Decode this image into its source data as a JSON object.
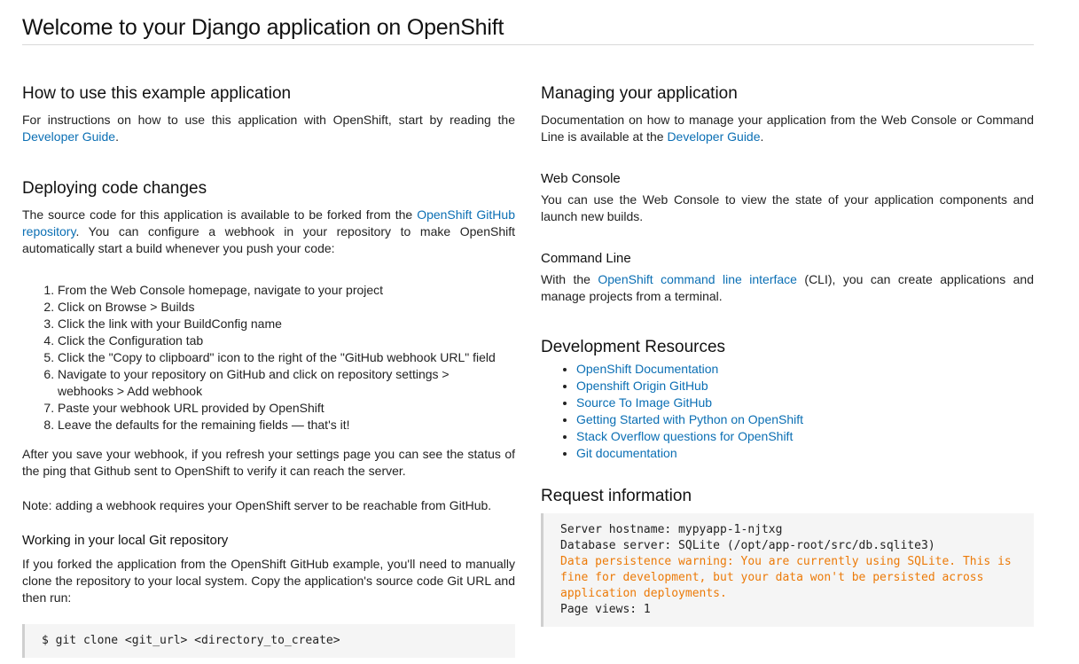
{
  "header": {
    "title": "Welcome to your Django application on OpenShift"
  },
  "left": {
    "how_to": {
      "heading": "How to use this example application",
      "text_before": "For instructions on how to use this application with OpenShift, start by reading the ",
      "link": "Developer Guide",
      "text_after": "."
    },
    "deploying": {
      "heading": "Deploying code changes",
      "text_before": "The source code for this application is available to be forked from the ",
      "link": "OpenShift GitHub repository",
      "text_after": ". You can configure a webhook in your repository to make OpenShift automatically start a build whenever you push your code:",
      "steps": [
        "From the Web Console homepage, navigate to your project",
        "Click on Browse > Builds",
        "Click the link with your BuildConfig name",
        "Click the Configuration tab",
        "Click the \"Copy to clipboard\" icon to the right of the \"GitHub webhook URL\" field",
        "Navigate to your repository on GitHub and click on repository settings > webhooks > Add webhook",
        "Paste your webhook URL provided by OpenShift",
        "Leave the defaults for the remaining fields — that's it!"
      ],
      "after_text": "After you save your webhook, if you refresh your settings page you can see the status of the ping that Github sent to OpenShift to verify it can reach the server.",
      "note": "Note: adding a webhook requires your OpenShift server to be reachable from GitHub."
    },
    "local_git": {
      "heading": "Working in your local Git repository",
      "text": "If you forked the application from the OpenShift GitHub example, you'll need to manually clone the repository to your local system. Copy the application's source code Git URL and then run:",
      "code": "$ git clone <git_url> <directory_to_create>"
    }
  },
  "right": {
    "managing": {
      "heading": "Managing your application",
      "text_before": "Documentation on how to manage your application from the Web Console or Command Line is available at the ",
      "link": "Developer Guide",
      "text_after": "."
    },
    "web_console": {
      "heading": "Web Console",
      "text": "You can use the Web Console to view the state of your application components and launch new builds."
    },
    "command_line": {
      "heading": "Command Line",
      "text_before": "With the ",
      "link": "OpenShift command line interface",
      "text_after": " (CLI), you can create applications and manage projects from a terminal."
    },
    "dev_resources": {
      "heading": "Development Resources",
      "links": [
        "OpenShift Documentation",
        "Openshift Origin GitHub",
        "Source To Image GitHub",
        "Getting Started with Python on OpenShift",
        "Stack Overflow questions for OpenShift",
        "Git documentation"
      ]
    },
    "request_info": {
      "heading": "Request information",
      "hostname_line": "Server hostname: mypyapp-1-njtxg",
      "database_line": "Database server: SQLite (/opt/app-root/src/db.sqlite3)",
      "warning_lines": [
        "Data persistence warning: You are currently using SQLite. This is",
        "fine for development, but your data won't be persisted across",
        "application deployments."
      ],
      "page_views_line": "Page views: 1",
      "warning_color": "#ec7a08"
    }
  }
}
